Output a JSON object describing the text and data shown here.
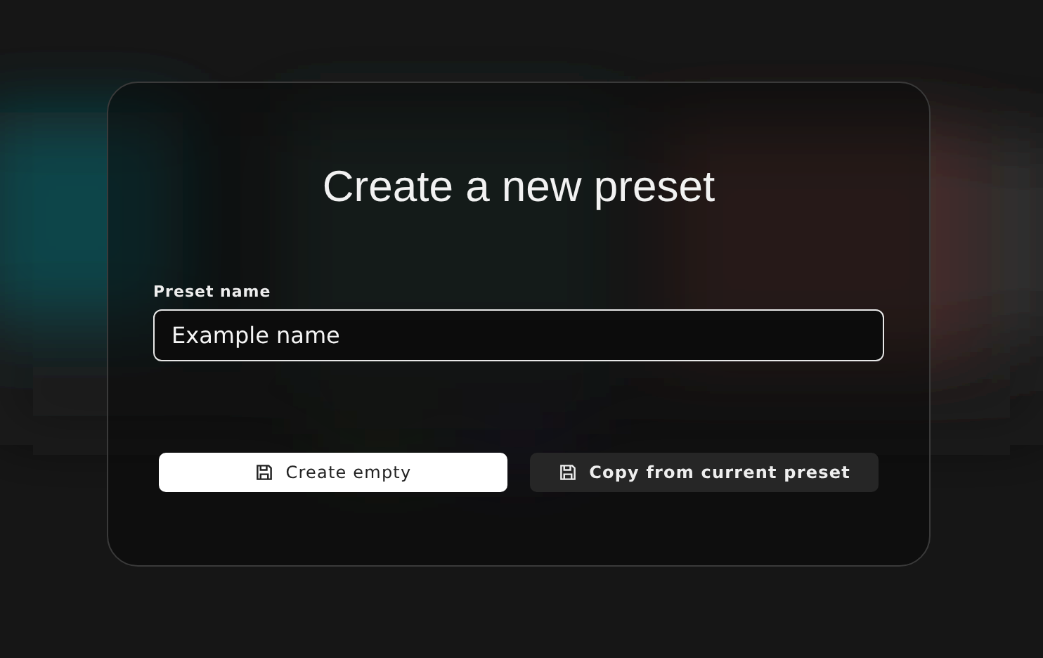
{
  "dialog": {
    "title": "Create a new preset",
    "field": {
      "label": "Preset name",
      "value": "Example name"
    },
    "buttons": [
      {
        "label": "Create empty",
        "kind": "primary"
      },
      {
        "label": "Copy from current preset",
        "kind": "secondary"
      }
    ]
  }
}
